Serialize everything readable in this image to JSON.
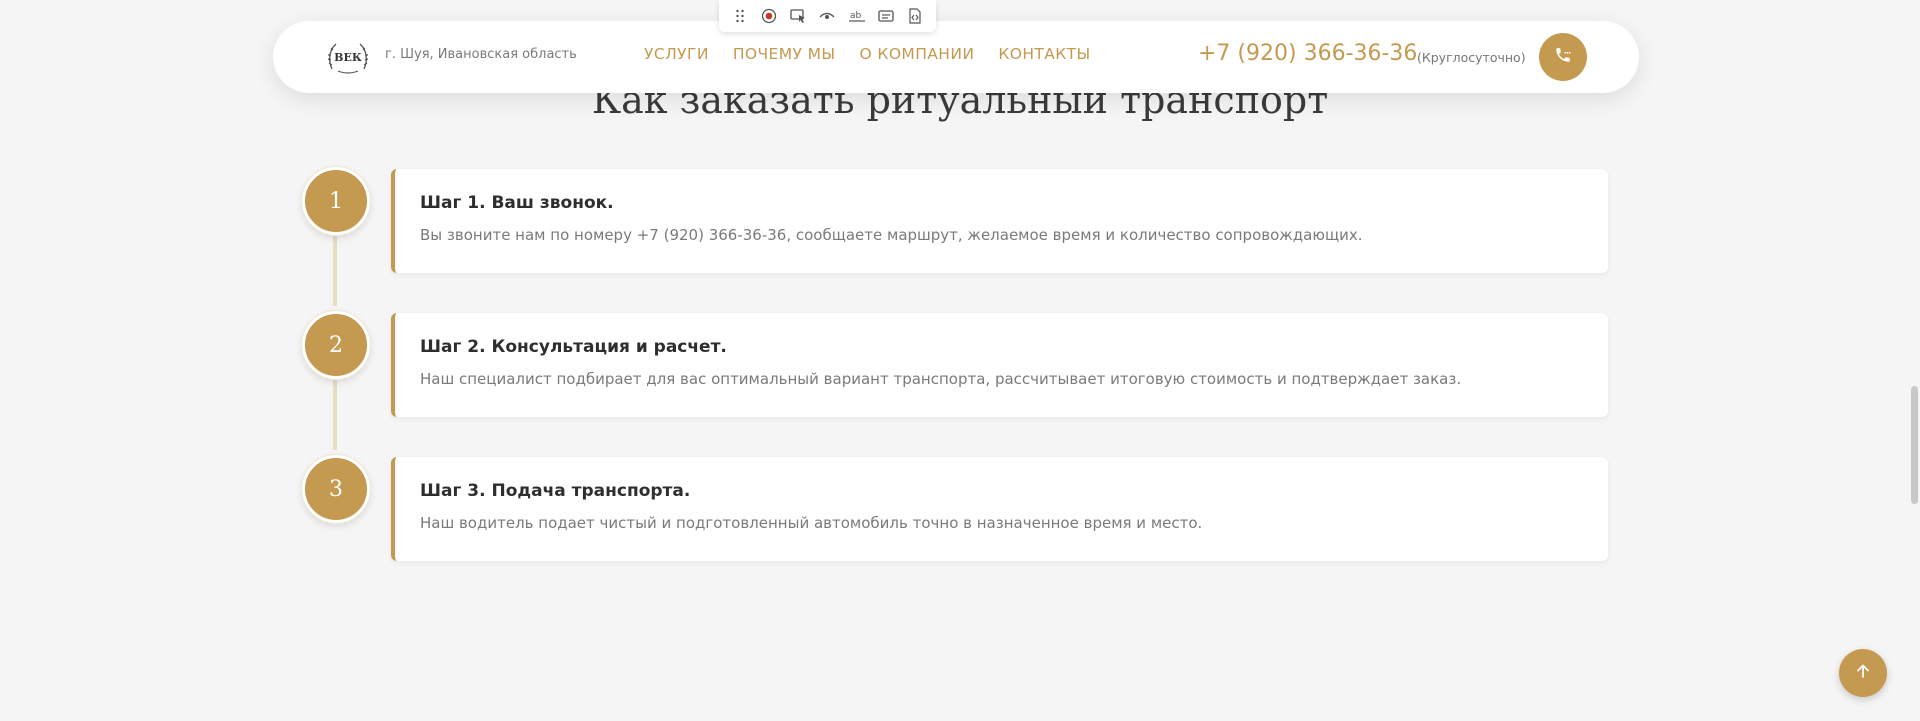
{
  "header": {
    "city": "г. Шуя, Ивановская область",
    "logo_text": "ВЕК",
    "nav": [
      "УСЛУГИ",
      "ПОЧЕМУ МЫ",
      "О КОМПАНИИ",
      "КОНТАКТЫ"
    ],
    "phone": "+7 (920) 366-36-36",
    "hours": "(Круглосуточно)",
    "call_icon": "phone-icon"
  },
  "toolbar": {
    "icons": [
      "drag-handle-icon",
      "record-icon",
      "select-element-icon",
      "preview-icon",
      "text-edit-icon",
      "caption-icon",
      "code-icon"
    ]
  },
  "section": {
    "title": "Как заказать ритуальный транспорт"
  },
  "steps": [
    {
      "number": "1",
      "title": "Шаг 1. Ваш звонок.",
      "text": "Вы звоните нам по номеру +7 (920) 366-36-36, сообщаете маршрут, желаемое время и количество сопровождающих."
    },
    {
      "number": "2",
      "title": "Шаг 2. Консультация и расчет.",
      "text": "Наш специалист подбирает для вас оптимальный вариант транспорта, рассчитывает итоговую стоимость и подтверждает заказ."
    },
    {
      "number": "3",
      "title": "Шаг 3. Подача транспорта.",
      "text": "Наш водитель подает чистый и подготовленный автомобиль точно в назначенное время и место."
    }
  ],
  "colors": {
    "accent": "#c49a51",
    "background": "#f5f5f5",
    "card": "#ffffff"
  },
  "scroll_top_icon": "arrow-up-icon"
}
